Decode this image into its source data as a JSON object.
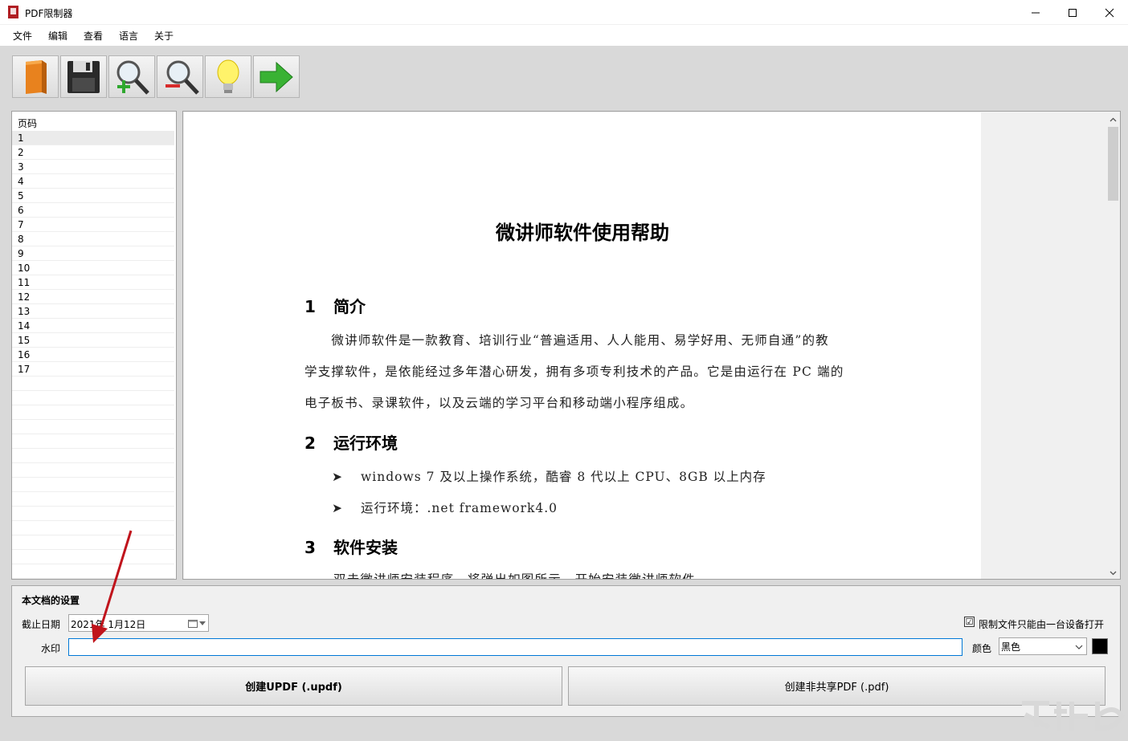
{
  "window": {
    "title": "PDF限制器",
    "controls": {
      "minimize": "─",
      "maximize": "☐",
      "close": "✕"
    }
  },
  "menu": {
    "items": [
      "文件",
      "编辑",
      "查看",
      "语言",
      "关于"
    ]
  },
  "toolbar": {
    "buttons": [
      {
        "name": "open-book-icon"
      },
      {
        "name": "save-disk-icon"
      },
      {
        "name": "zoom-in-icon"
      },
      {
        "name": "zoom-out-icon"
      },
      {
        "name": "lightbulb-icon"
      },
      {
        "name": "arrow-right-icon"
      }
    ]
  },
  "page_list": {
    "header": "页码",
    "pages": [
      "1",
      "2",
      "3",
      "4",
      "5",
      "6",
      "7",
      "8",
      "9",
      "10",
      "11",
      "12",
      "13",
      "14",
      "15",
      "16",
      "17"
    ],
    "selected": "1"
  },
  "document": {
    "title": "微讲师软件使用帮助",
    "sections": [
      {
        "num": "1",
        "heading": "简介"
      },
      {
        "num": "2",
        "heading": "运行环境"
      },
      {
        "num": "3",
        "heading": "软件安装"
      }
    ],
    "intro_lines": [
      "　　微讲师软件是一款教育、培训行业“普遍适用、人人能用、易学好用、无师自通”的教",
      "学支撑软件，是依能经过多年潜心研发，拥有多项专利技术的产品。它是由运行在 PC 端的",
      "电子板书、录课软件，以及云端的学习平台和移动端小程序组成。"
    ],
    "bullets": [
      "windows 7 及以上操作系统，酷睿 8 代以上 CPU、8GB 以上内存",
      "运行环境：.net framework4.0"
    ],
    "bullet_mark": "➤",
    "install_line": "双击微讲师安装程序，将弹出如图所示，开始安装微讲师软件。"
  },
  "settings": {
    "group_title": "本文档的设置",
    "expiry_label": "截止日期",
    "expiry_value": "2021年 1月12日",
    "limit_device_checked": "☑",
    "limit_device_label": "限制文件只能由一台设备打开",
    "watermark_label": "水印",
    "watermark_value": "",
    "color_label": "颜色",
    "color_value": "黑色",
    "color_swatch": "#000000",
    "btn_updf": "创建UPDF (.updf)",
    "btn_pdf": "创建非共享PDF (.pdf)"
  },
  "colors": {
    "annotation_arrow": "#c0141c",
    "focus_border": "#0078d7"
  }
}
